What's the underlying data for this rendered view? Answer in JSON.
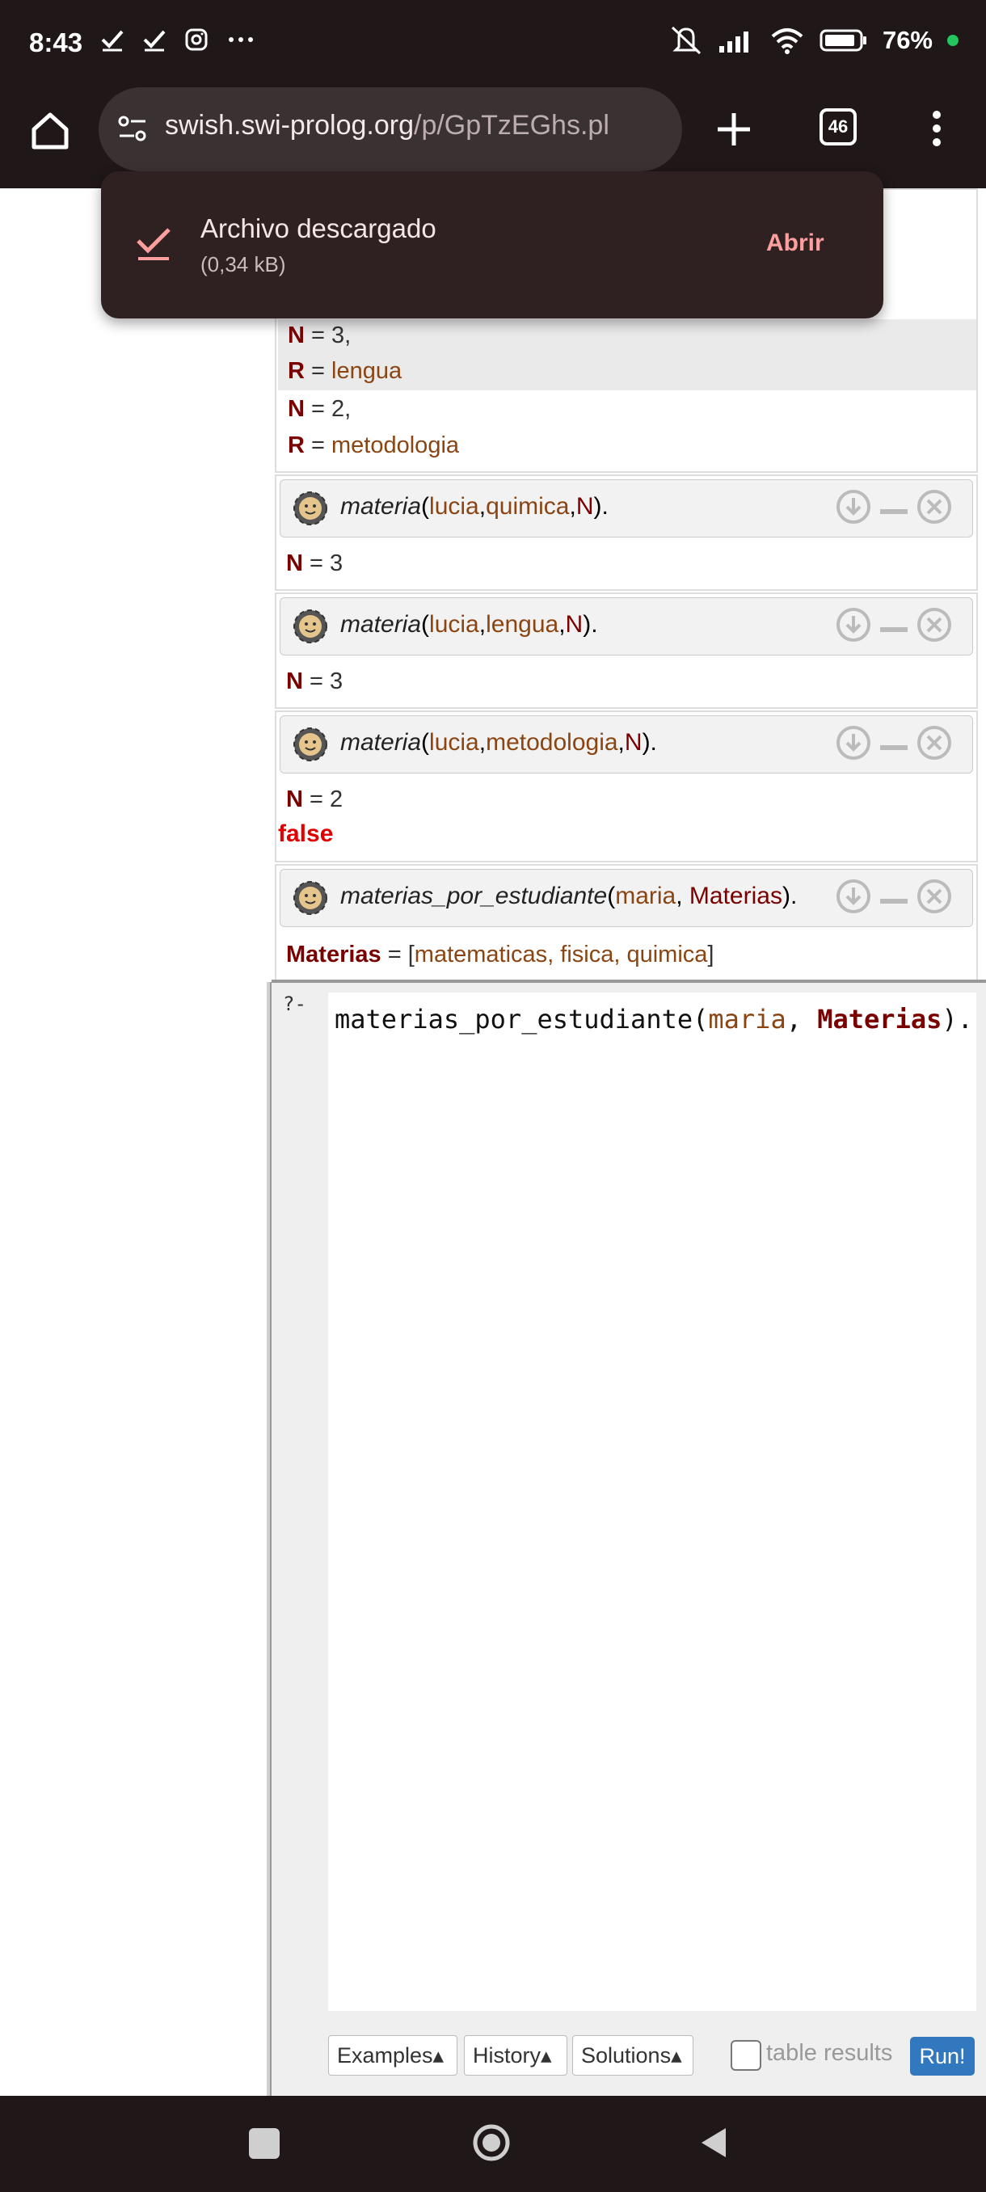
{
  "status_bar": {
    "time": "8:43",
    "battery": "76%",
    "left_icons": [
      "check-icon",
      "check-icon",
      "instagram-icon",
      "more-icon"
    ],
    "right_icons": [
      "mute-icon",
      "signal-icon",
      "wifi-icon",
      "battery-icon"
    ]
  },
  "browser": {
    "url_host": "swish.swi-prolog.org",
    "url_path": "/p/GpTzEGhs.pl",
    "tab_count": "46"
  },
  "toast": {
    "title": "Archivo descargado",
    "size": "(0,34 kB)",
    "action": "Abrir"
  },
  "results": {
    "prev_answers": [
      {
        "var": "N",
        "rest": " = 3,"
      },
      {
        "var": "R",
        "eq": " = ",
        "value": "lengua"
      },
      {
        "var": "N",
        "rest": " = 2,"
      },
      {
        "var": "R",
        "eq": " = ",
        "value": "metodologia"
      }
    ],
    "queries": [
      {
        "pred": "materia",
        "open": "(",
        "arg1": "lucia",
        "arg2": "quimica",
        "argvar": "N",
        "close": ").",
        "answer_var": "N",
        "answer_rest": " = 3"
      },
      {
        "pred": "materia",
        "open": "(",
        "arg1": "lucia",
        "arg2": "lengua",
        "argvar": "N",
        "close": ").",
        "answer_var": "N",
        "answer_rest": " = 3"
      },
      {
        "pred": "materia",
        "open": "(",
        "arg1": "lucia",
        "arg2": "metodologia",
        "argvar": "N",
        "close": ").",
        "answer_var": "N",
        "answer_rest": " = 2",
        "status": "false"
      },
      {
        "pred": "materias_por_estudiante",
        "open": "(",
        "arg1": "maria",
        "sep": ", ",
        "argvar": "Materias",
        "close": ").",
        "answer_var": "Materias",
        "answer_eq": " = [",
        "answer_list": "matematicas, fisica, quimica",
        "answer_close": "]"
      }
    ]
  },
  "editor": {
    "prompt": "?-",
    "code_pred": "materias_por_estudiante(",
    "code_atom": "maria",
    "code_sep": ", ",
    "code_var": "Materias",
    "code_close": ").",
    "buttons": [
      "Examples▴",
      "History▴",
      "Solutions▴"
    ],
    "table_results_label": "table results",
    "run_label": "Run!"
  }
}
